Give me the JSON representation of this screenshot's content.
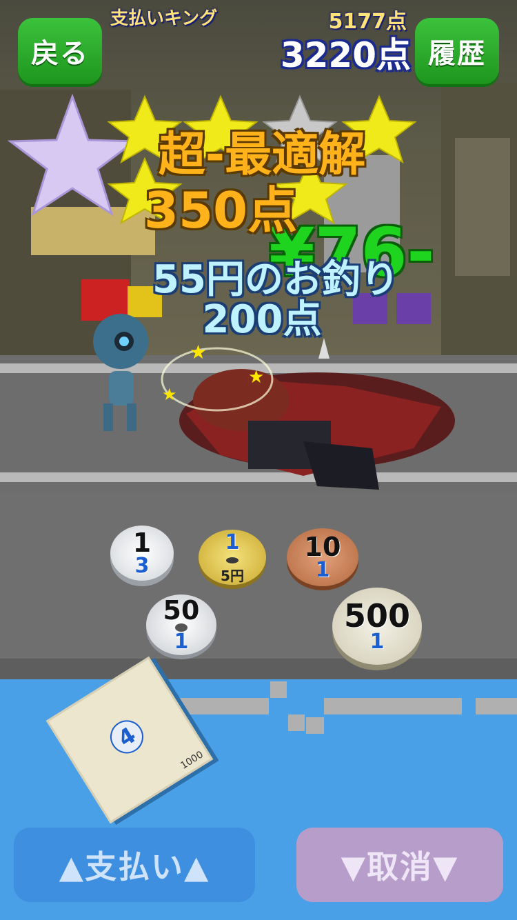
{
  "header": {
    "back_label": "戻る",
    "history_label": "履歴",
    "player_title": "支払いキング",
    "best_score": "5177点",
    "current_score": "3220点"
  },
  "result": {
    "rank_text": "超-最適解",
    "rank_points": "350点",
    "price_text": "¥76-",
    "change_text": "55円のお釣り",
    "change_points": "200点"
  },
  "coins": [
    {
      "face": "1",
      "count": "3"
    },
    {
      "face": "1",
      "count": "",
      "sub": "5円"
    },
    {
      "face": "10",
      "count": "1"
    },
    {
      "face": "50",
      "count": "1"
    },
    {
      "face": "500",
      "count": "1"
    }
  ],
  "bill": {
    "count": "4",
    "denomination": "1000"
  },
  "footer": {
    "pay_label": "▲支払い▲",
    "cancel_label": "▼取消▼"
  },
  "colors": {
    "top_button": "#2aaa2a",
    "pay_button": "#3f8fe0",
    "cancel_button": "#b79dc9",
    "water": "#4aa0e6"
  }
}
